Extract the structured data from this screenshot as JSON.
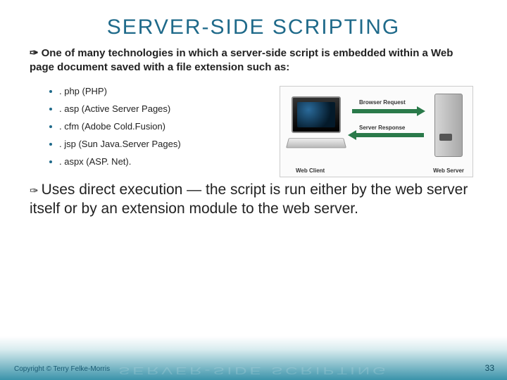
{
  "title": "SERVER-SIDE  SCRIPTING",
  "para1": "One of many technologies in which a server-side script is embedded within a Web page document saved with a file extension such as:",
  "items": [
    ". php (PHP)",
    ". asp (Active Server Pages)",
    ". cfm (Adobe Cold.Fusion)",
    ". jsp (Sun Java.Server Pages)",
    ". aspx (ASP. Net)."
  ],
  "para2": "Uses direct execution — the script is run either by the web server itself or by an extension module to the web server.",
  "diagram": {
    "request_label": "Browser Request",
    "response_label": "Server Response",
    "client_label": "Web Client",
    "server_label": "Web Server"
  },
  "copyright": "Copyright © Terry Felke-Morris",
  "page_number": "33"
}
